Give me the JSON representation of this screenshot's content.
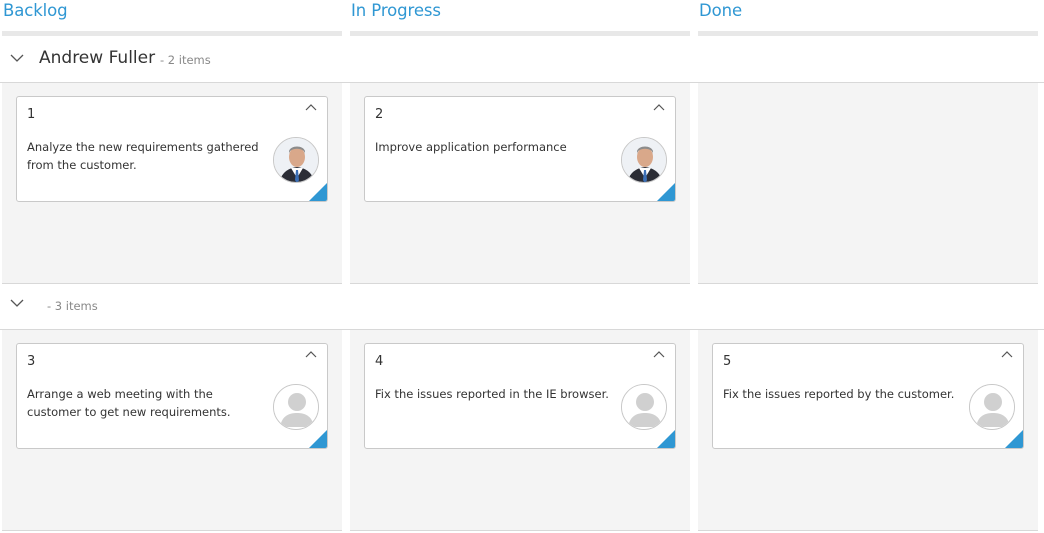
{
  "columns": [
    {
      "title": "Backlog"
    },
    {
      "title": "In Progress"
    },
    {
      "title": "Done"
    }
  ],
  "swimlanes": [
    {
      "name": "Andrew Fuller",
      "count_text": "- 2 items",
      "cards": [
        {
          "column": 0,
          "id": "1",
          "summary": "Analyze the new requirements gathered from the customer.",
          "avatar": "person-photo-icon"
        },
        {
          "column": 1,
          "id": "2",
          "summary": "Improve application performance",
          "avatar": "person-photo-icon"
        }
      ]
    },
    {
      "name": "",
      "count_text": "- 3 items",
      "cards": [
        {
          "column": 0,
          "id": "3",
          "summary": "Arrange a web meeting with the customer to get new requirements.",
          "avatar": "default-user-icon"
        },
        {
          "column": 1,
          "id": "4",
          "summary": "Fix the issues reported in the IE browser.",
          "avatar": "default-user-icon"
        },
        {
          "column": 2,
          "id": "5",
          "summary": "Fix the issues reported by the customer.",
          "avatar": "default-user-icon"
        }
      ]
    }
  ],
  "colors": {
    "accent": "#2f97d3",
    "cell_bg": "#f4f4f4",
    "border": "#d8d8d8"
  }
}
